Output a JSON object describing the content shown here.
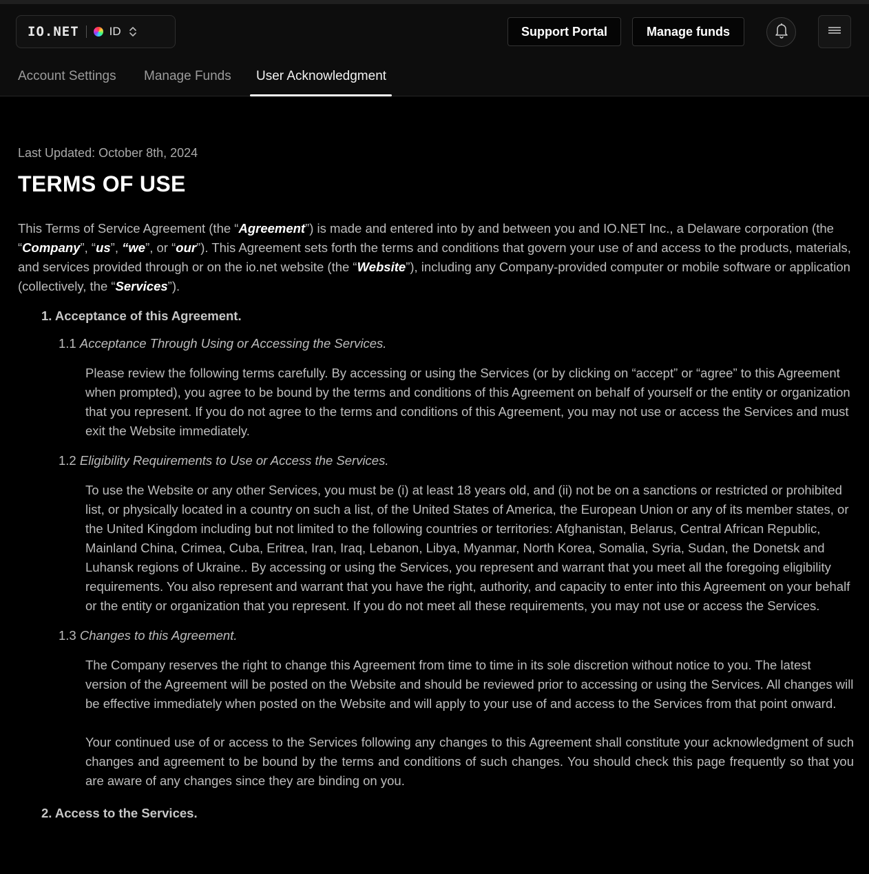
{
  "header": {
    "logo_text": "IO.NET",
    "id_label": "ID",
    "support_portal_label": "Support Portal",
    "manage_funds_label": "Manage funds",
    "icons": {
      "bell": "bell-icon",
      "menu": "hamburger-menu-icon",
      "switch": "chevron-updown-icon"
    }
  },
  "tabs": [
    {
      "label": "Account Settings",
      "active": false
    },
    {
      "label": "Manage Funds",
      "active": false
    },
    {
      "label": "User Acknowledgment",
      "active": true
    }
  ],
  "doc": {
    "last_updated": "Last Updated: October 8th, 2024",
    "title": "TERMS OF USE",
    "intro": {
      "p1": "This Terms of Service Agreement (the “",
      "t1": "Agreement",
      "p2": "”) is made and entered into by and between you and IO.NET Inc., a Delaware corporation (the “",
      "t2": "Company",
      "p3": "”, “",
      "t3": "us",
      "p4": "”, ",
      "t4": "“we",
      "p5": "”, or “",
      "t5": "our",
      "p6": "”). This Agreement sets forth the terms and conditions that govern your use of and access to the products, materials, and services provided through or on the io.net website (the “",
      "t6": "Website",
      "p7": "”), including any Company-provided computer or mobile software or application (collectively, the “",
      "t7": "Services",
      "p8": "”)."
    },
    "section1_title": "1. Acceptance of this Agreement.",
    "s1_1": {
      "num": "1.1",
      "title": "Acceptance Through Using or Accessing the Services.",
      "body": "Please review the following terms carefully. By accessing or using the Services (or by clicking on “accept” or “agree” to this Agreement when prompted), you agree to be bound by the terms and conditions of this Agreement on behalf of yourself or the entity or organization that you represent. If you do not agree to the terms and conditions of this Agreement, you may not use or access the Services and must exit the Website immediately."
    },
    "s1_2": {
      "num": "1.2",
      "title": "Eligibility Requirements to Use or Access the Services.",
      "body": "To use the Website or any other Services, you must be (i) at least 18 years old, and (ii) not be on a sanctions or restricted or prohibited list, or physically located in a country on such a list, of the United States of America, the European Union or any of its member states, or the United Kingdom including but not limited to the following countries or territories: Afghanistan, Belarus, Central African Republic, Mainland China, Crimea, Cuba, Eritrea, Iran, Iraq, Lebanon, Libya, Myanmar, North Korea, Somalia, Syria, Sudan, the Donetsk and Luhansk regions of Ukraine.. By accessing or using the Services, you represent and warrant that you meet all the foregoing eligibility requirements. You also represent and warrant that you have the right, authority, and capacity to enter into this Agreement on your behalf or the entity or organization that you represent. If you do not meet all these requirements, you may not use or access the Services."
    },
    "s1_3": {
      "num": "1.3",
      "title": "Changes to this Agreement.",
      "body1": "The Company reserves the right to change this Agreement from time to time in its sole discretion without notice to you. The latest version of the Agreement will be posted on the Website and should be reviewed prior to accessing or using the Services. All changes will be effective immediately when posted on the Website and will apply to your use of and access to the Services from that point onward.",
      "body2": "Your continued use of or access to the Services following any changes to this Agreement shall constitute your acknowledgment of such changes and agreement to be bound by the terms and conditions of such changes. You should check this page frequently so that you are aware of any changes since they are binding on you."
    },
    "next_section_partial": "2. Access to the Services."
  }
}
